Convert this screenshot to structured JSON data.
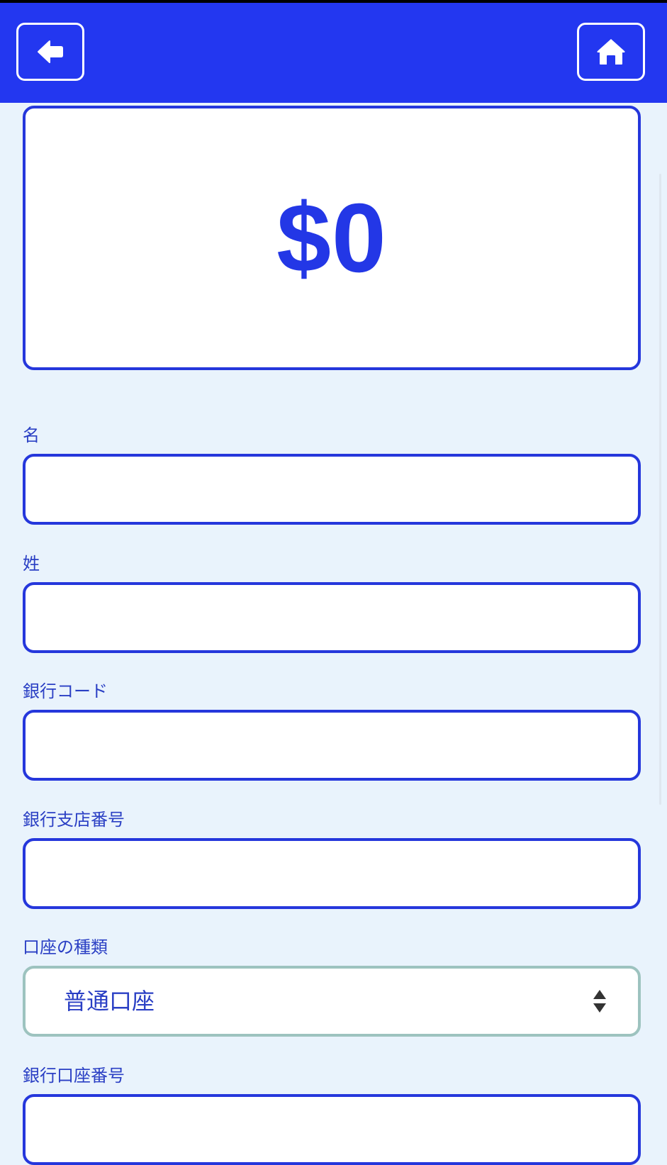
{
  "header": {
    "back_icon": "arrow-left-icon",
    "home_icon": "home-icon"
  },
  "amount": {
    "value": "$0"
  },
  "form": {
    "first_name": {
      "label": "名",
      "value": ""
    },
    "last_name": {
      "label": "姓",
      "value": ""
    },
    "bank_code": {
      "label": "銀行コード",
      "value": ""
    },
    "branch_number": {
      "label": "銀行支店番号",
      "value": ""
    },
    "account_type": {
      "label": "口座の種類",
      "selected": "普通口座",
      "icon": "select-arrows-icon"
    },
    "account_number": {
      "label": "銀行口座番号",
      "value": ""
    }
  },
  "colors": {
    "header_bg": "#2337f0",
    "page_bg": "#e9f3fc",
    "accent": "#2537dc",
    "select_border": "#9dc3bf"
  }
}
